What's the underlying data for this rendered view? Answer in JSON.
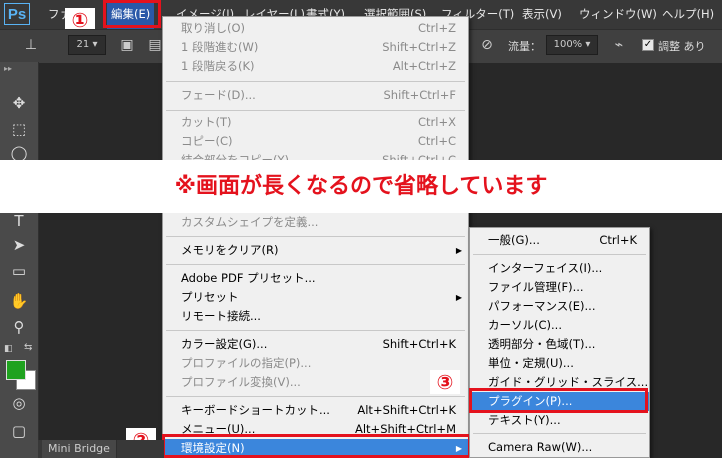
{
  "menubar": {
    "logo": "Ps",
    "items": [
      {
        "label": "ファイル"
      },
      {
        "label": "編集(E)"
      },
      {
        "label": "イメージ(I)"
      },
      {
        "label": "レイヤー(L)"
      },
      {
        "label": "書式(Y)"
      },
      {
        "label": "選択範囲(S)"
      },
      {
        "label": "フィルター(T)"
      },
      {
        "label": "表示(V)"
      },
      {
        "label": "ウィンドウ(W)"
      },
      {
        "label": "ヘルプ(H)"
      }
    ]
  },
  "optionbar": {
    "brush_size": "21",
    "flow_label": "流量：",
    "flow_value": "100%",
    "smoothing_label": "調整 あり"
  },
  "annotations": {
    "step1": "①",
    "step2": "②",
    "step3": "③",
    "banner": "※画面が長くなるので省略しています",
    "accent_color": "#e4121d"
  },
  "edit_menu": {
    "top_items": [
      {
        "label": "取り消し(O)",
        "shortcut": "Ctrl+Z",
        "disabled": true
      },
      {
        "label": "1 段階進む(W)",
        "shortcut": "Shift+Ctrl+Z",
        "disabled": true
      },
      {
        "label": "1 段階戻る(K)",
        "shortcut": "Alt+Ctrl+Z",
        "disabled": true
      },
      {
        "label": "フェード(D)...",
        "shortcut": "Shift+Ctrl+F",
        "disabled": true
      },
      {
        "label": "カット(T)",
        "shortcut": "Ctrl+X",
        "disabled": true
      },
      {
        "label": "コピー(C)",
        "shortcut": "Ctrl+C",
        "disabled": true
      },
      {
        "label": "結合部分をコピー(Y)",
        "shortcut": "Shift+Ctrl+C",
        "disabled": true
      }
    ],
    "bottom_items": [
      {
        "label": "カスタムシェイプを定義...",
        "shortcut": "",
        "disabled": true
      },
      {
        "label": "メモリをクリア(R)",
        "shortcut": "",
        "disabled": false,
        "submenu": true
      },
      {
        "label": "Adobe PDF プリセット...",
        "shortcut": "",
        "disabled": false
      },
      {
        "label": "プリセット",
        "shortcut": "",
        "disabled": false,
        "submenu": true
      },
      {
        "label": "リモート接続...",
        "shortcut": "",
        "disabled": false
      },
      {
        "label": "カラー設定(G)...",
        "shortcut": "Shift+Ctrl+K",
        "disabled": false
      },
      {
        "label": "プロファイルの指定(P)...",
        "shortcut": "",
        "disabled": true
      },
      {
        "label": "プロファイル変換(V)...",
        "shortcut": "",
        "disabled": true
      },
      {
        "label": "キーボードショートカット...",
        "shortcut": "Alt+Shift+Ctrl+K",
        "disabled": false
      },
      {
        "label": "メニュー(U)...",
        "shortcut": "Alt+Shift+Ctrl+M",
        "disabled": false
      },
      {
        "label": "環境設定(N)",
        "shortcut": "",
        "disabled": false,
        "submenu": true,
        "highlighted": true
      }
    ]
  },
  "prefs_submenu": {
    "items": [
      {
        "label": "一般(G)...",
        "shortcut": "Ctrl+K"
      },
      {
        "label": "インターフェイス(I)..."
      },
      {
        "label": "ファイル管理(F)..."
      },
      {
        "label": "パフォーマンス(E)..."
      },
      {
        "label": "カーソル(C)..."
      },
      {
        "label": "透明部分・色域(T)..."
      },
      {
        "label": "単位・定規(U)..."
      },
      {
        "label": "ガイド・グリッド・スライス..."
      },
      {
        "label": "プラグイン(P)...",
        "highlighted": true
      },
      {
        "label": "テキスト(Y)..."
      },
      {
        "label": "Camera Raw(W)..."
      }
    ]
  },
  "bottom_tabs": [
    "Mini Bridge"
  ],
  "colors": {
    "foreground": "#1fa21f",
    "background": "#ffffff"
  }
}
